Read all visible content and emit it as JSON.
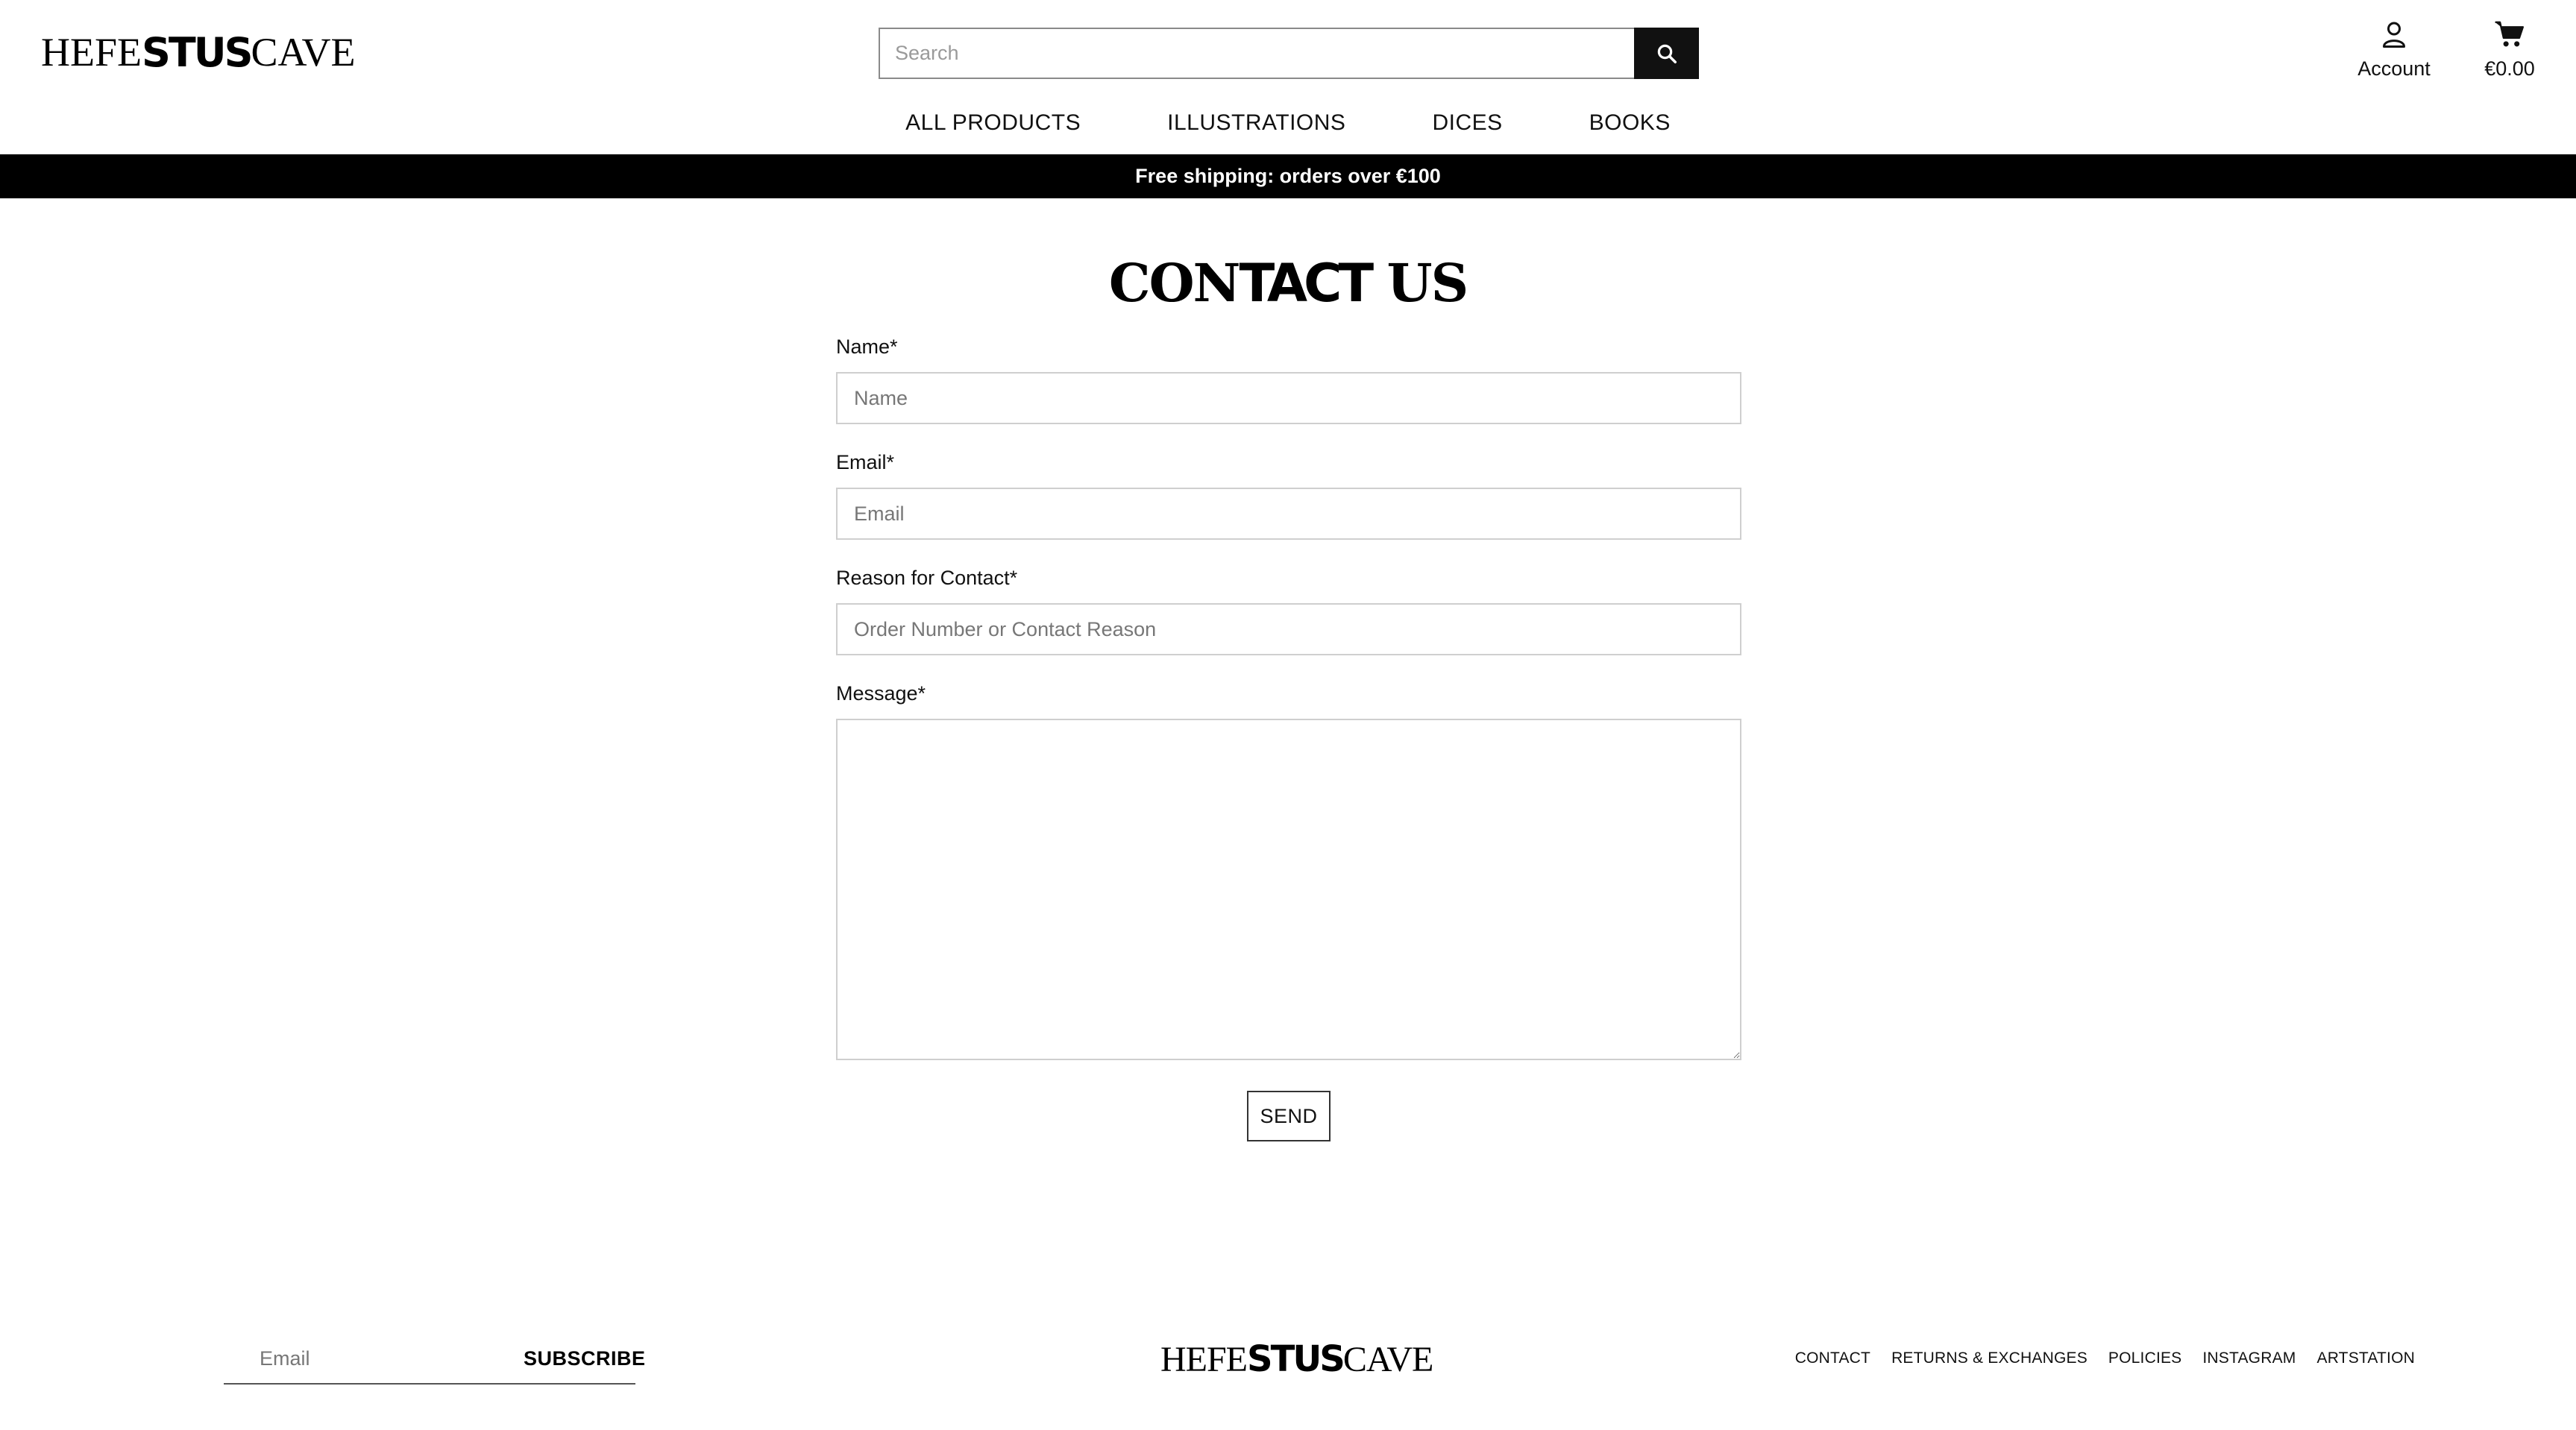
{
  "header": {
    "logo": {
      "part1": "HEFE",
      "part2": "STUS",
      "part3": "CAVE"
    },
    "search": {
      "placeholder": "Search"
    },
    "account_label": "Account",
    "cart_total": "€0.00",
    "nav": [
      "ALL PRODUCTS",
      "ILLUSTRATIONS",
      "DICES",
      "BOOKS"
    ]
  },
  "banner": {
    "text": "Free shipping: orders over €100"
  },
  "page": {
    "title_part1": "CON",
    "title_part2": "TACT",
    "title_part3": " US"
  },
  "form": {
    "name": {
      "label": "Name*",
      "placeholder": "Name",
      "value": ""
    },
    "email": {
      "label": "Email*",
      "placeholder": "Email",
      "value": ""
    },
    "reason": {
      "label": "Reason for Contact*",
      "placeholder": "Order Number or Contact Reason",
      "value": ""
    },
    "message": {
      "label": "Message*",
      "value": ""
    },
    "send_label": "SEND"
  },
  "footer": {
    "newsletter": {
      "placeholder": "Email",
      "button_label": "SUBSCRIBE"
    },
    "logo": {
      "part1": "HEFE",
      "part2": "STUS",
      "part3": "CAVE"
    },
    "links": [
      "CONTACT",
      "RETURNS & EXCHANGES",
      "POLICIES",
      "INSTAGRAM",
      "ARTSTATION"
    ]
  }
}
